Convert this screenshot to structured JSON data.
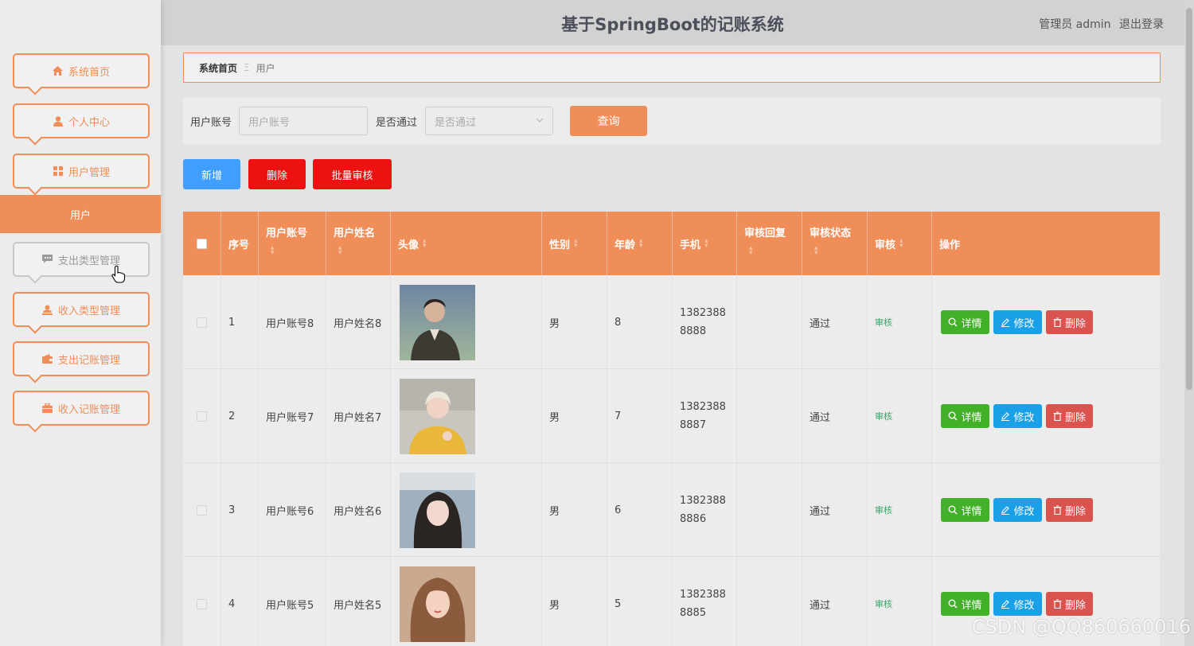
{
  "app": {
    "title": "基于SpringBoot的记账系统"
  },
  "header": {
    "admin_label": "管理员 admin",
    "logout": "退出登录"
  },
  "sidebar": {
    "items": [
      {
        "label": "系统首页",
        "icon": "home-icon"
      },
      {
        "label": "个人中心",
        "icon": "user-icon"
      },
      {
        "label": "用户管理",
        "icon": "grid-icon"
      },
      {
        "label": "支出类型管理",
        "icon": "comment-icon"
      },
      {
        "label": "收入类型管理",
        "icon": "user-upload-icon"
      },
      {
        "label": "支出记账管理",
        "icon": "wallet-icon"
      },
      {
        "label": "收入记账管理",
        "icon": "briefcase-icon"
      }
    ],
    "active_sub": "用户"
  },
  "breadcrumb": {
    "home": "系统首页",
    "current": "用户"
  },
  "search": {
    "account_label": "用户账号",
    "account_placeholder": "用户账号",
    "approved_label": "是否通过",
    "approved_placeholder": "是否通过",
    "query": "查询"
  },
  "actions": {
    "add": "新增",
    "delete": "删除",
    "batch_audit": "批量审核"
  },
  "table": {
    "headers": {
      "index": "序号",
      "account": "用户账号",
      "name": "用户姓名",
      "avatar": "头像",
      "gender": "性别",
      "age": "年龄",
      "phone": "手机",
      "reply": "审核回复",
      "status": "审核状态",
      "audit": "审核",
      "ops": "操作"
    },
    "op_labels": {
      "detail": "详情",
      "edit": "修改",
      "delete": "删除",
      "audit": "审核"
    },
    "rows": [
      {
        "index": "1",
        "account": "用户账号8",
        "name": "用户姓名8",
        "gender": "男",
        "age": "8",
        "phone_1": "1382388",
        "phone_2": "8888",
        "reply": "",
        "status": "通过"
      },
      {
        "index": "2",
        "account": "用户账号7",
        "name": "用户姓名7",
        "gender": "男",
        "age": "7",
        "phone_1": "1382388",
        "phone_2": "8887",
        "reply": "",
        "status": "通过"
      },
      {
        "index": "3",
        "account": "用户账号6",
        "name": "用户姓名6",
        "gender": "男",
        "age": "6",
        "phone_1": "1382388",
        "phone_2": "8886",
        "reply": "",
        "status": "通过"
      },
      {
        "index": "4",
        "account": "用户账号5",
        "name": "用户姓名5",
        "gender": "男",
        "age": "5",
        "phone_1": "1382388",
        "phone_2": "8885",
        "reply": "",
        "status": "通过"
      }
    ]
  },
  "watermark": "CSDN @QQ860660016",
  "colors": {
    "accent": "#ef8e59",
    "primary": "#409eff",
    "danger": "#ee1111",
    "success": "#43b02a",
    "info": "#1aa0e6",
    "delete_op": "#d9534f"
  }
}
